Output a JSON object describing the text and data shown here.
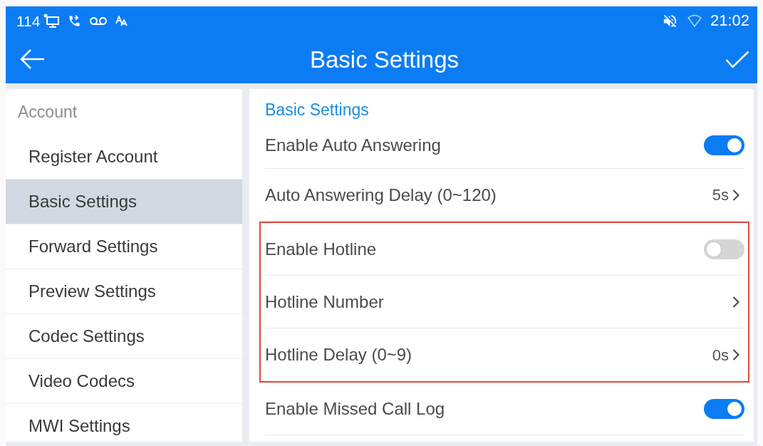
{
  "status_bar": {
    "left_text": "114",
    "time": "21:02"
  },
  "toolbar": {
    "title": "Basic Settings"
  },
  "sidebar": {
    "section": "Account",
    "items": [
      {
        "label": "Register Account",
        "selected": false
      },
      {
        "label": "Basic Settings",
        "selected": true
      },
      {
        "label": "Forward Settings",
        "selected": false
      },
      {
        "label": "Preview Settings",
        "selected": false
      },
      {
        "label": "Codec Settings",
        "selected": false
      },
      {
        "label": "Video Codecs",
        "selected": false
      },
      {
        "label": "MWI Settings",
        "selected": false
      }
    ]
  },
  "panel": {
    "heading": "Basic Settings",
    "items": [
      {
        "kind": "toggle",
        "label": "Enable Auto Answering",
        "on": true,
        "highlighted": false
      },
      {
        "kind": "value",
        "label": "Auto Answering Delay (0~120)",
        "value": "5s",
        "highlighted": false
      },
      {
        "kind": "toggle",
        "label": "Enable Hotline",
        "on": false,
        "highlighted": true
      },
      {
        "kind": "value",
        "label": "Hotline Number",
        "highlighted": true
      },
      {
        "kind": "value",
        "label": "Hotline Delay (0~9)",
        "value": "0s",
        "highlighted": true
      },
      {
        "kind": "toggle",
        "label": "Enable Missed Call Log",
        "on": true,
        "highlighted": false
      }
    ]
  }
}
